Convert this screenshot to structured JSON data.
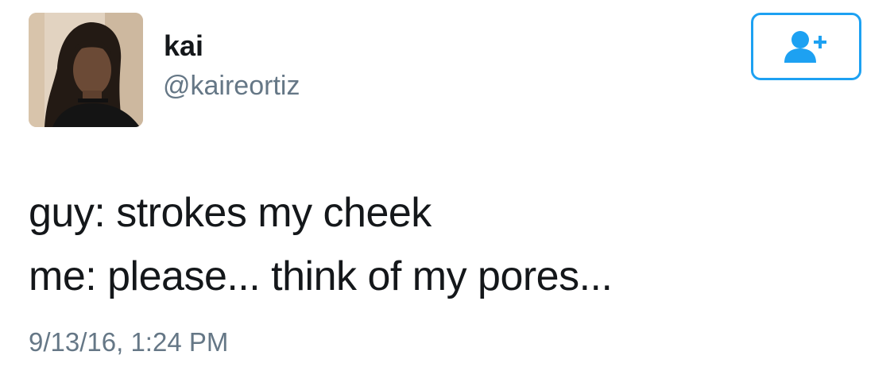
{
  "user": {
    "display_name": "kai",
    "handle": "@kaireortiz",
    "avatar_icon": "profile-photo"
  },
  "follow_button": {
    "icon": "add-user-icon",
    "accent_color": "#1da1f2"
  },
  "tweet": {
    "lines": [
      "guy: strokes my cheek",
      "me: please... think of my pores..."
    ],
    "timestamp": "9/13/16, 1:24 PM"
  }
}
